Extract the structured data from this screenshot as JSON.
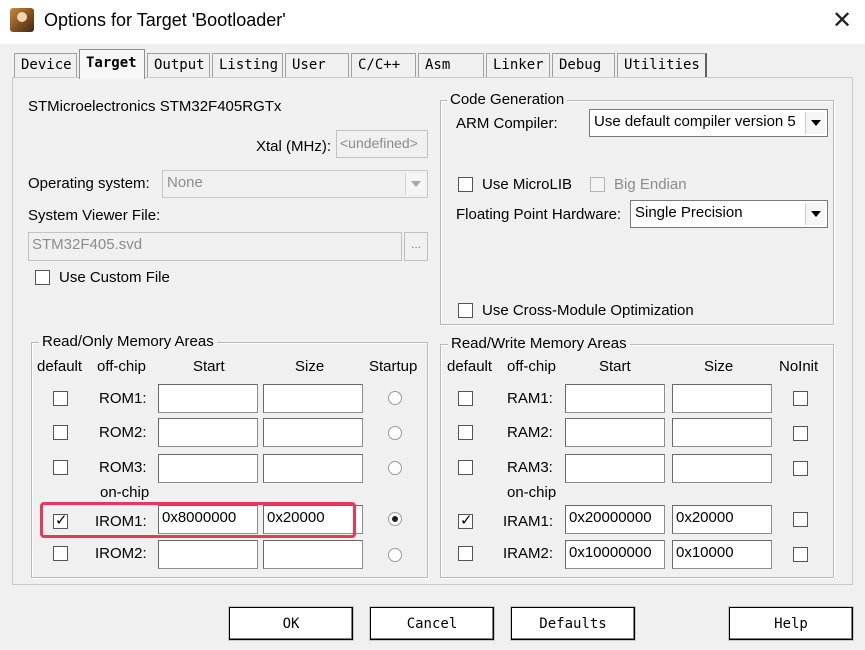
{
  "window": {
    "title": "Options for Target 'Bootloader'",
    "close_glyph": "✕"
  },
  "tabs": [
    {
      "label": "Device"
    },
    {
      "label": "Target",
      "active": true
    },
    {
      "label": "Output"
    },
    {
      "label": "Listing"
    },
    {
      "label": "User"
    },
    {
      "label": "C/C++"
    },
    {
      "label": "Asm"
    },
    {
      "label": "Linker"
    },
    {
      "label": "Debug"
    },
    {
      "label": "Utilities"
    }
  ],
  "device": {
    "name": "STMicroelectronics STM32F405RGTx",
    "xtal_label": "Xtal (MHz):",
    "xtal_value": "<undefined>",
    "os_label": "Operating system:",
    "os_value": "None",
    "svd_label": "System Viewer File:",
    "svd_value": "STM32F405.svd",
    "browse_label": "...",
    "custom_file_label": "Use Custom File",
    "custom_file_checked": false
  },
  "code_generation": {
    "title": "Code Generation",
    "compiler_label": "ARM Compiler:",
    "compiler_value": "Use default compiler version 5",
    "microlib_label": "Use MicroLIB",
    "microlib_checked": false,
    "big_endian_label": "Big Endian",
    "big_endian_checked": false,
    "fpu_label": "Floating Point Hardware:",
    "fpu_value": "Single Precision",
    "cross_module_label": "Use Cross-Module Optimization",
    "cross_module_checked": false
  },
  "rom_areas": {
    "title": "Read/Only Memory Areas",
    "headers": {
      "default": "default",
      "offchip": "off-chip",
      "start": "Start",
      "size": "Size",
      "startup": "Startup"
    },
    "onchip_label": "on-chip",
    "rows": [
      {
        "name": "ROM1:",
        "default": false,
        "start": "",
        "size": "",
        "startup": false
      },
      {
        "name": "ROM2:",
        "default": false,
        "start": "",
        "size": "",
        "startup": false
      },
      {
        "name": "ROM3:",
        "default": false,
        "start": "",
        "size": "",
        "startup": false
      },
      {
        "name": "IROM1:",
        "default": true,
        "start": "0x8000000",
        "size": "0x20000",
        "startup": true
      },
      {
        "name": "IROM2:",
        "default": false,
        "start": "",
        "size": "",
        "startup": false
      }
    ]
  },
  "ram_areas": {
    "title": "Read/Write Memory Areas",
    "headers": {
      "default": "default",
      "offchip": "off-chip",
      "start": "Start",
      "size": "Size",
      "noinit": "NoInit"
    },
    "onchip_label": "on-chip",
    "rows": [
      {
        "name": "RAM1:",
        "default": false,
        "start": "",
        "size": "",
        "noinit": false
      },
      {
        "name": "RAM2:",
        "default": false,
        "start": "",
        "size": "",
        "noinit": false
      },
      {
        "name": "RAM3:",
        "default": false,
        "start": "",
        "size": "",
        "noinit": false
      },
      {
        "name": "IRAM1:",
        "default": true,
        "start": "0x20000000",
        "size": "0x20000",
        "noinit": false
      },
      {
        "name": "IRAM2:",
        "default": false,
        "start": "0x10000000",
        "size": "0x10000",
        "noinit": false
      }
    ]
  },
  "buttons": {
    "ok": "OK",
    "cancel": "Cancel",
    "defaults": "Defaults",
    "help": "Help"
  },
  "colors": {
    "highlight": "#e8385a"
  },
  "check_glyph": "✓"
}
